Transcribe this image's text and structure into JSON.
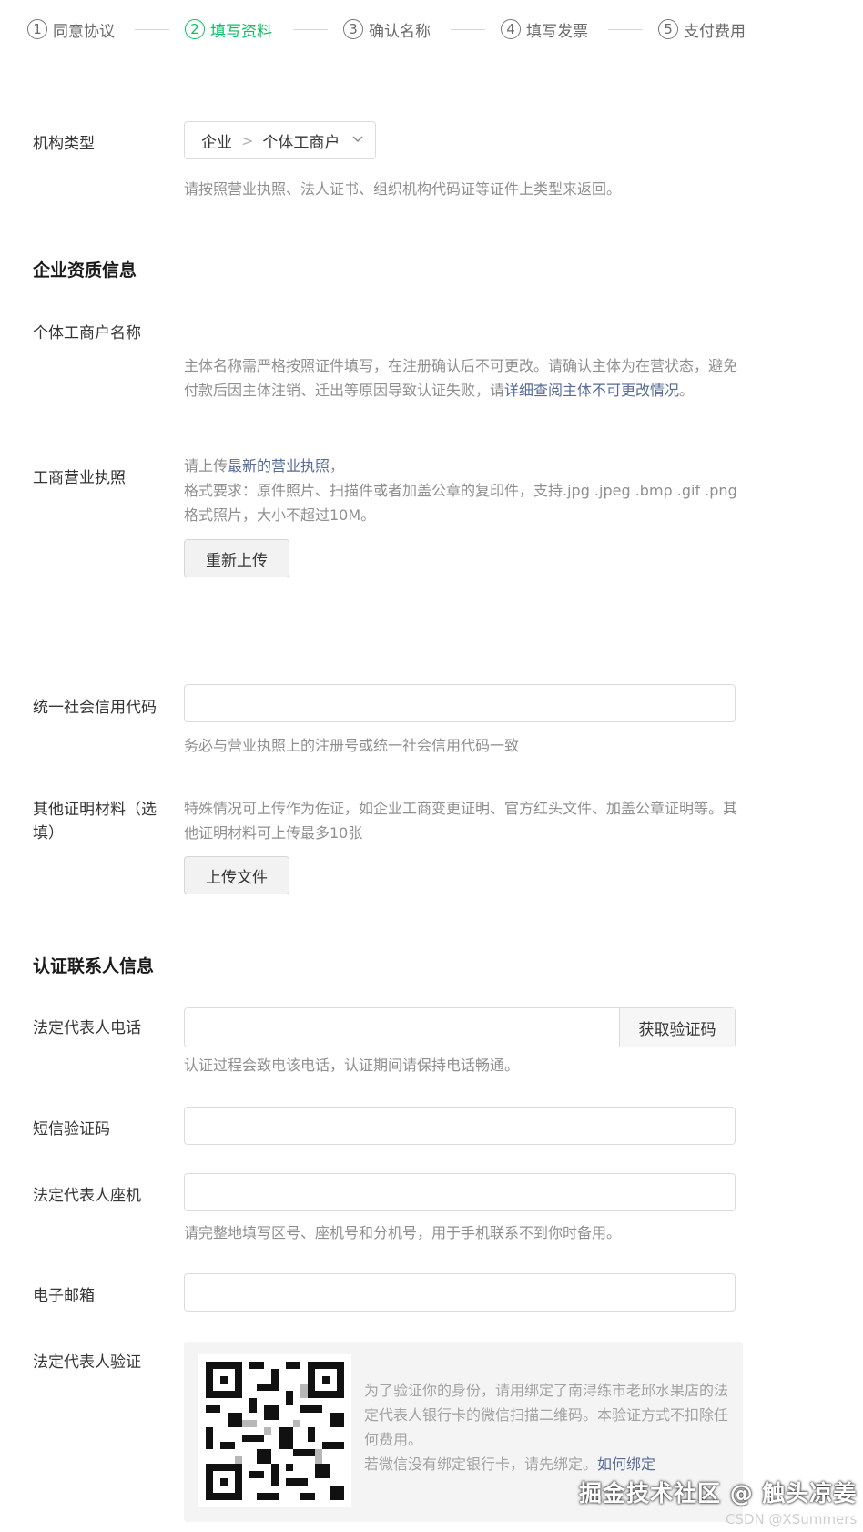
{
  "steps": [
    {
      "num": "1",
      "label": "同意协议"
    },
    {
      "num": "2",
      "label": "填写资料"
    },
    {
      "num": "3",
      "label": "确认名称"
    },
    {
      "num": "4",
      "label": "填写发票"
    },
    {
      "num": "5",
      "label": "支付费用"
    }
  ],
  "org_type": {
    "label": "机构类型",
    "level1": "企业",
    "level2": "个体工商户",
    "hint": "请按照营业执照、法人证书、组织机构代码证等证件上类型来返回。"
  },
  "qualification": {
    "title": "企业资质信息",
    "name_label": "个体工商户名称",
    "name_hint_1": "主体名称需严格按照证件填写，在注册确认后不可更改。请确认主体为在营状态，避免付款后因主体注销、迁出等原因导致认证失败，请",
    "name_hint_link": "详细查阅主体不可更改情况",
    "name_hint_end": "。",
    "license_label": "工商营业执照",
    "license_hint_prefix": "请上传",
    "license_hint_link": "最新的营业执照",
    "license_hint_suffix": "，",
    "license_format": "格式要求：原件照片、扫描件或者加盖公章的复印件，支持.jpg .jpeg .bmp .gif .png格式照片，大小不超过10M。",
    "reupload_button": "重新上传",
    "credit_label": "统一社会信用代码",
    "credit_hint": "务必与营业执照上的注册号或统一社会信用代码一致",
    "other_label": "其他证明材料（选填）",
    "other_hint": "特殊情况可上传作为佐证，如企业工商变更证明、官方红头文件、加盖公章证明等。其他证明材料可上传最多10张",
    "upload_button": "上传文件"
  },
  "contact": {
    "title": "认证联系人信息",
    "phone_label": "法定代表人电话",
    "get_code_button": "获取验证码",
    "phone_hint": "认证过程会致电该电话，认证期间请保持电话畅通。",
    "sms_label": "短信验证码",
    "landline_label": "法定代表人座机",
    "landline_hint": "请完整地填写区号、座机号和分机号，用于手机联系不到你时备用。",
    "email_label": "电子邮箱",
    "verify_label": "法定代表人验证",
    "verify_text": "为了验证你的身份，请用绑定了南浔练市老邱水果店的法定代表人银行卡的微信扫描二维码。本验证方式不扣除任何费用。",
    "verify_text2": "若微信没有绑定银行卡，请先绑定。",
    "verify_link": "如何绑定"
  },
  "watermark": {
    "main": "掘金技术社区 @ 触头凉姜",
    "csdn": "CSDN @XSummers"
  },
  "colors": {
    "accent": "#07c160",
    "link": "#576b95",
    "hint": "#8f8f8f"
  }
}
